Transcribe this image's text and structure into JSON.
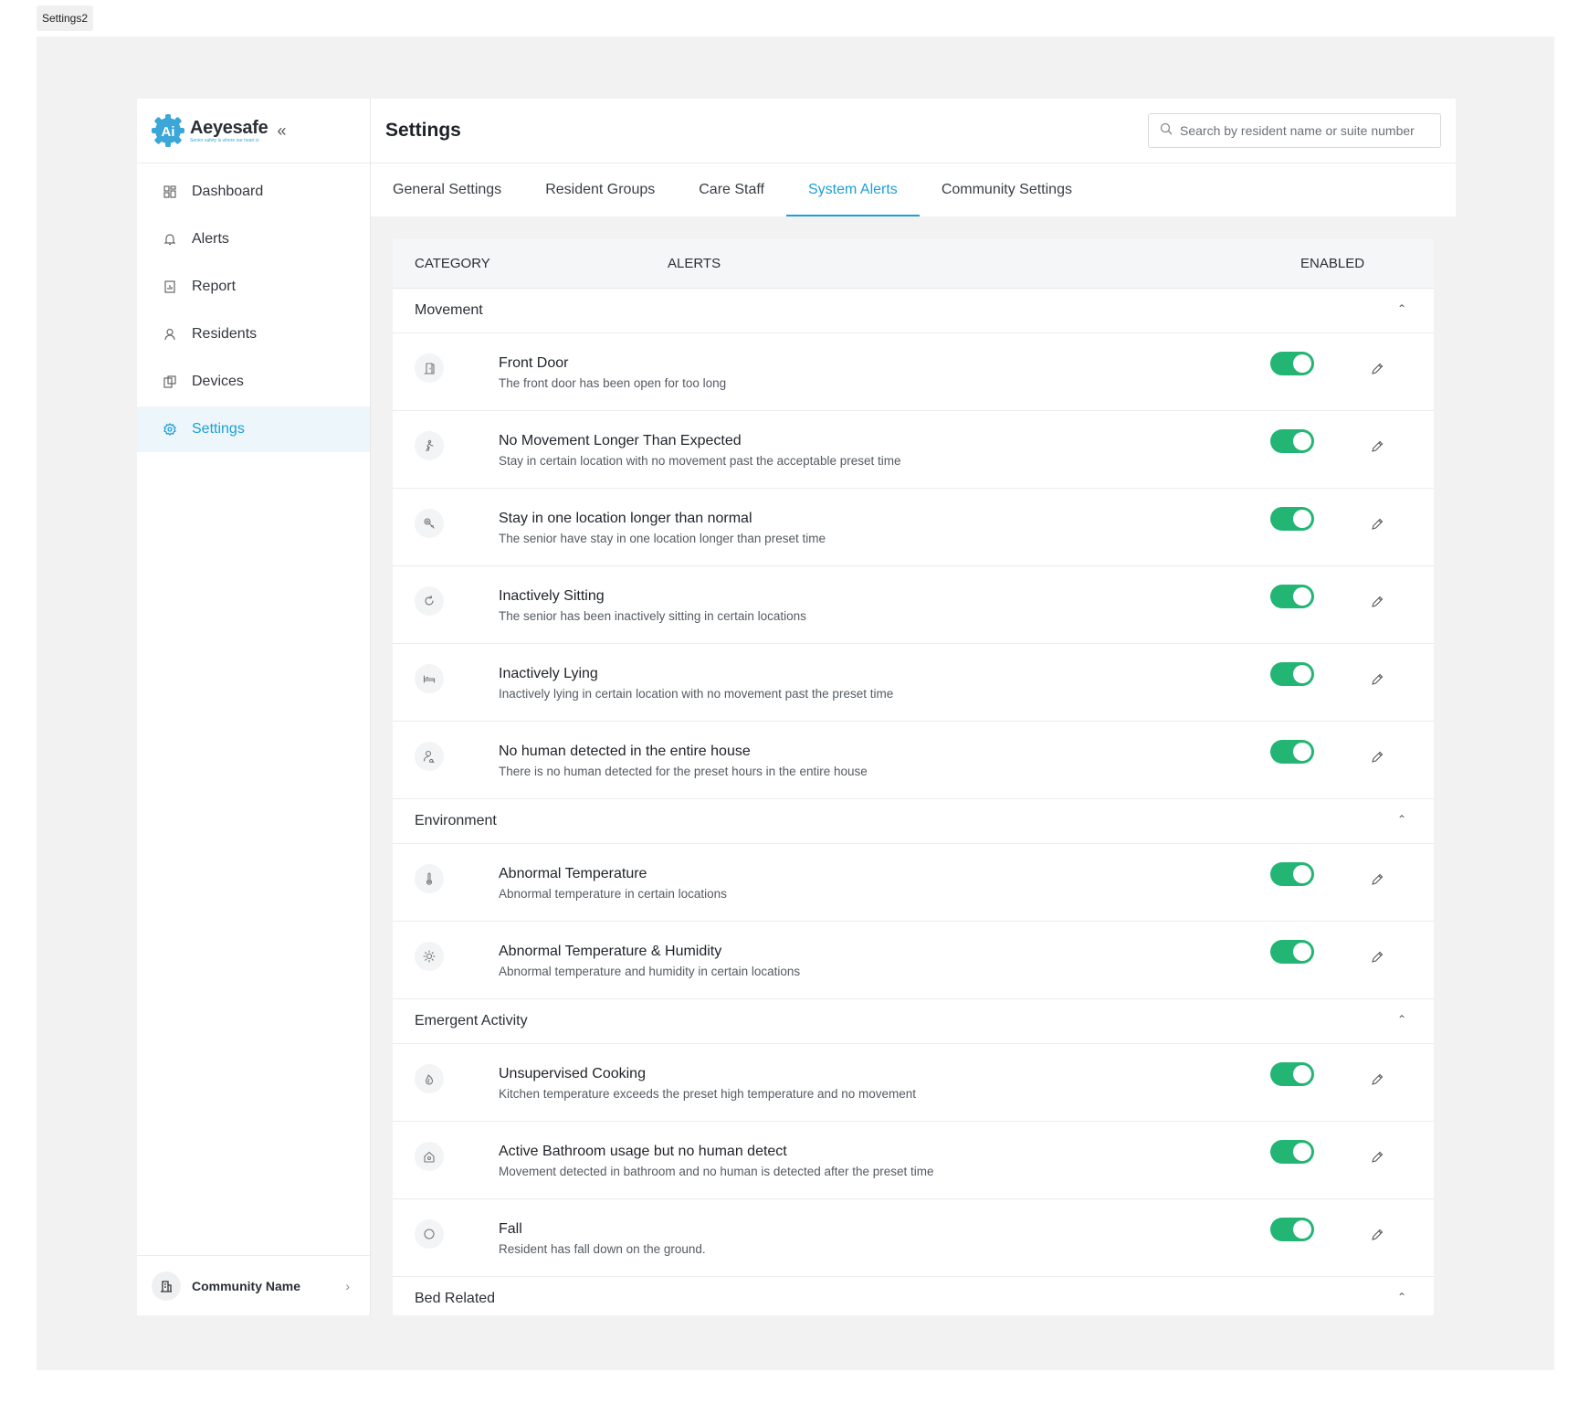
{
  "frame_label": "Settings2",
  "brand": {
    "name": "Aeyesafe",
    "tagline": "Senior safety is where our heart is",
    "logo_letters": "Ai"
  },
  "sidebar": {
    "items": [
      {
        "label": "Dashboard",
        "icon": "dashboard-icon"
      },
      {
        "label": "Alerts",
        "icon": "bell-icon"
      },
      {
        "label": "Report",
        "icon": "report-icon"
      },
      {
        "label": "Residents",
        "icon": "person-icon"
      },
      {
        "label": "Devices",
        "icon": "devices-icon"
      },
      {
        "label": "Settings",
        "icon": "gear-icon",
        "active": true
      }
    ],
    "community": "Community Name"
  },
  "header": {
    "title": "Settings",
    "search_placeholder": "Search by resident name or suite number"
  },
  "tabs": [
    {
      "label": "General Settings"
    },
    {
      "label": "Resident Groups"
    },
    {
      "label": "Care Staff"
    },
    {
      "label": "System Alerts",
      "active": true
    },
    {
      "label": "Community Settings"
    }
  ],
  "table": {
    "columns": {
      "category": "CATEGORY",
      "alerts": "ALERTS",
      "enabled": "ENABLED"
    },
    "groups": [
      {
        "name": "Movement",
        "rows": [
          {
            "title": "Front Door",
            "desc": "The front door has been open for too long",
            "icon": "door-icon",
            "enabled": true
          },
          {
            "title": "No Movement Longer Than Expected",
            "desc": "Stay in certain location with no movement past the acceptable preset time",
            "icon": "walking-icon",
            "enabled": true
          },
          {
            "title": "Stay in one location longer than normal",
            "desc": "The senior have stay in one location longer than preset time",
            "icon": "location-icon",
            "enabled": true
          },
          {
            "title": "Inactively Sitting",
            "desc": "The senior has been inactively sitting in certain locations",
            "icon": "refresh-icon",
            "enabled": true
          },
          {
            "title": "Inactively Lying",
            "desc": "Inactively lying in certain location with no movement past the preset time",
            "icon": "bed-icon",
            "enabled": true
          },
          {
            "title": "No human detected in the entire house",
            "desc": "There is no human detected for the preset hours in the entire house",
            "icon": "person-search-icon",
            "enabled": true
          }
        ]
      },
      {
        "name": "Environment",
        "rows": [
          {
            "title": "Abnormal Temperature",
            "desc": "Abnormal temperature in certain locations",
            "icon": "thermometer-icon",
            "enabled": true
          },
          {
            "title": "Abnormal Temperature & Humidity",
            "desc": "Abnormal temperature and humidity in certain locations",
            "icon": "sun-icon",
            "enabled": true
          }
        ]
      },
      {
        "name": "Emergent Activity",
        "rows": [
          {
            "title": "Unsupervised Cooking",
            "desc": "Kitchen temperature exceeds the preset high temperature and no movement",
            "icon": "flame-icon",
            "enabled": true
          },
          {
            "title": "Active Bathroom usage but no human detect",
            "desc": "Movement detected in bathroom and no human is detected after the preset time",
            "icon": "home-icon",
            "enabled": true
          },
          {
            "title": "Fall",
            "desc": "Resident has fall down on the ground.",
            "icon": "circle-icon",
            "enabled": true
          }
        ]
      },
      {
        "name": "Bed Related",
        "rows": []
      }
    ]
  },
  "colors": {
    "accent": "#1e9fd6",
    "toggle_on": "#22b573",
    "logo": "#3ba7d8"
  }
}
